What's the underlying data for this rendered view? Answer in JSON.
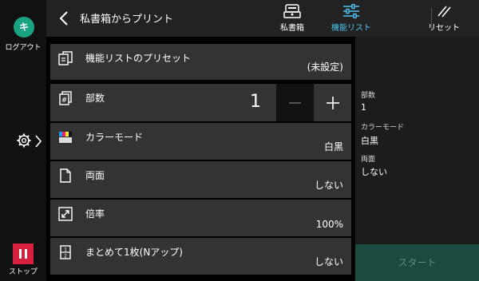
{
  "left": {
    "logout_icon_glyph": "キ",
    "logout_label": "ログアウト",
    "stop_label": "ストップ"
  },
  "header": {
    "title": "私書箱からプリント",
    "mailbox_label": "私書箱",
    "feature_list_label": "機能リスト",
    "reset_label": "リセット",
    "accent": "#4fc3f7"
  },
  "rows": {
    "preset_label": "機能リストのプリセット",
    "preset_value": "(未設定)",
    "copies_label": "部数",
    "copies_value": "1",
    "color_label": "カラーモード",
    "color_value": "白黒",
    "duplex_label": "両面",
    "duplex_value": "しない",
    "scale_label": "倍率",
    "scale_value": "100%",
    "nup_label": "まとめて1枚(Nアップ)",
    "nup_value": "しない"
  },
  "summary": {
    "copies_head": "部数",
    "copies_val": "1",
    "color_head": "カラーモード",
    "color_val": "白黒",
    "duplex_head": "両面",
    "duplex_val": "しない"
  },
  "start_label": "スタート"
}
